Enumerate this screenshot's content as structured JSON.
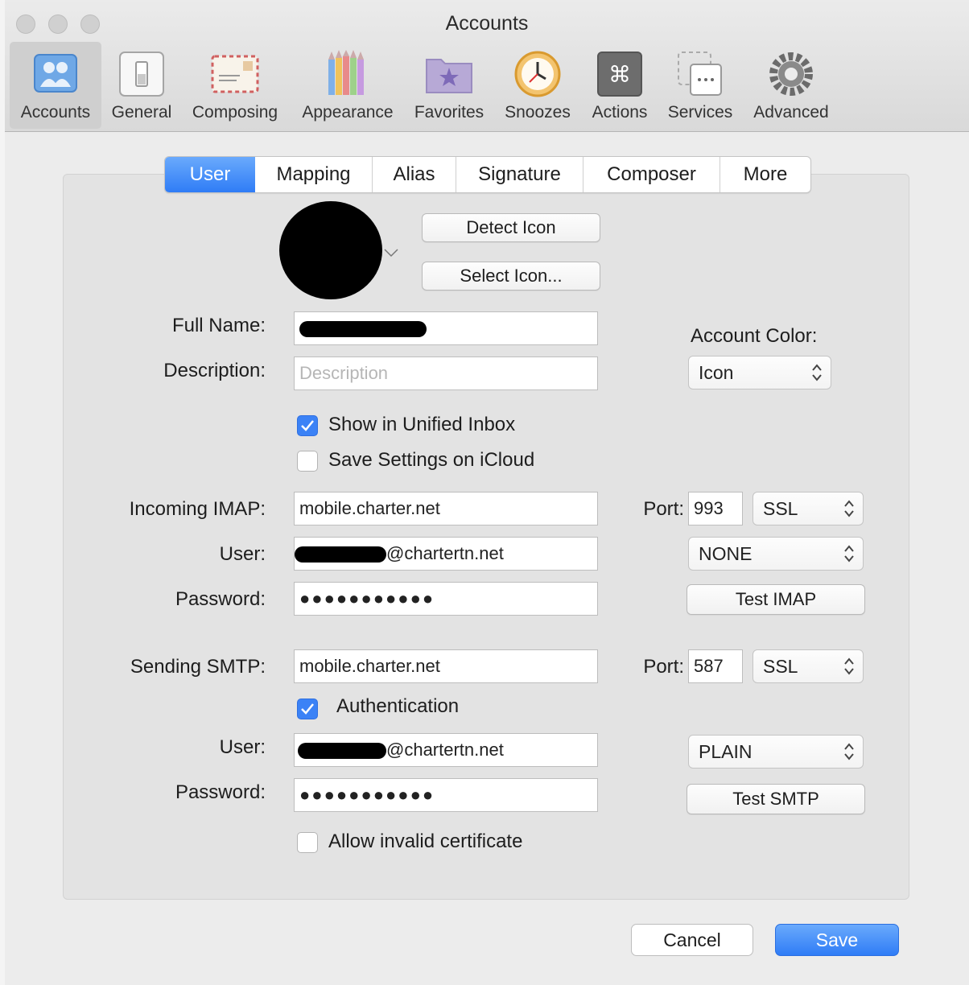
{
  "window": {
    "title": "Accounts"
  },
  "toolbar": {
    "items": [
      {
        "label": "Accounts",
        "icon": "accounts-icon",
        "selected": true
      },
      {
        "label": "General",
        "icon": "general-switch-icon"
      },
      {
        "label": "Composing",
        "icon": "envelope-icon"
      },
      {
        "label": "Appearance",
        "icon": "pencils-icon"
      },
      {
        "label": "Favorites",
        "icon": "star-folder-icon"
      },
      {
        "label": "Snoozes",
        "icon": "clock-icon"
      },
      {
        "label": "Actions",
        "icon": "command-icon"
      },
      {
        "label": "Services",
        "icon": "services-icon"
      },
      {
        "label": "Advanced",
        "icon": "gear-icon"
      }
    ]
  },
  "tabs": [
    "User",
    "Mapping",
    "Alias",
    "Signature",
    "Composer",
    "More"
  ],
  "active_tab": "User",
  "icon_buttons": {
    "detect": "Detect Icon",
    "select": "Select Icon..."
  },
  "form": {
    "full_name_label": "Full Name:",
    "description_label": "Description:",
    "description_placeholder": "Description",
    "account_color_label": "Account Color:",
    "account_color_value": "Icon",
    "show_unified_label": "Show in Unified Inbox",
    "show_unified_checked": true,
    "save_icloud_label": "Save Settings on iCloud",
    "save_icloud_checked": false
  },
  "incoming": {
    "label": "Incoming IMAP:",
    "server": "mobile.charter.net",
    "port_label": "Port:",
    "port": "993",
    "security": "SSL",
    "user_label": "User:",
    "user_suffix": "@chartertn.net",
    "auth": "NONE",
    "password_label": "Password:",
    "password_mask": "●●●●●●●●●●●",
    "test_button": "Test IMAP"
  },
  "sending": {
    "label": "Sending SMTP:",
    "server": "mobile.charter.net",
    "port_label": "Port:",
    "port": "587",
    "security": "SSL",
    "authentication_label": "Authentication",
    "authentication_checked": true,
    "user_label": "User:",
    "user_suffix": "@chartertn.net",
    "auth": "PLAIN",
    "password_label": "Password:",
    "password_mask": "●●●●●●●●●●●",
    "test_button": "Test SMTP"
  },
  "allow_invalid_label": "Allow invalid certificate",
  "allow_invalid_checked": false,
  "footer": {
    "cancel": "Cancel",
    "save": "Save"
  },
  "colors": {
    "accent": "#3b82f6",
    "window": "#ececec",
    "group": "#e3e3e3"
  }
}
